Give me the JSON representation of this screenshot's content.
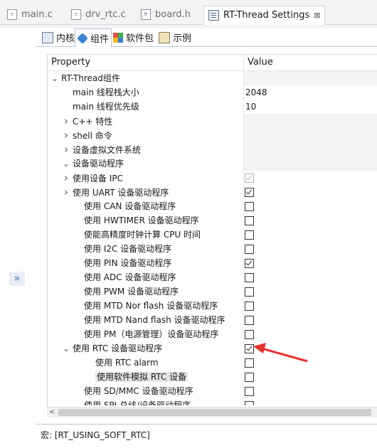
{
  "editor_tabs": [
    {
      "label": "main.c",
      "icon": "c-file-icon",
      "active": false
    },
    {
      "label": "drv_rtc.c",
      "icon": "c-file-icon",
      "active": false
    },
    {
      "label": "board.h",
      "icon": "h-file-icon",
      "active": false
    },
    {
      "label": "RT-Thread Settings",
      "icon": "settings-icon",
      "active": true
    }
  ],
  "close_glyph": "⊠",
  "collapse_glyph": "»",
  "settings_tabs": [
    {
      "label": "内核",
      "icon": "kernel-icon"
    },
    {
      "label": "组件",
      "icon": "component-icon",
      "active": true
    },
    {
      "label": "软件包",
      "icon": "package-icon"
    },
    {
      "label": "示例",
      "icon": "example-icon"
    }
  ],
  "table": {
    "col_property": "Property",
    "col_value": "Value",
    "rows": [
      {
        "label": "RT-Thread组件",
        "indent": 0,
        "twisty": "v",
        "value_type": "none",
        "gray": true
      },
      {
        "label": "main 线程栈大小",
        "indent": 2,
        "twisty": "",
        "value_type": "text",
        "value": "2048"
      },
      {
        "label": "main 线程优先级",
        "indent": 2,
        "twisty": "",
        "value_type": "text",
        "value": "10"
      },
      {
        "label": "C++ 特性",
        "indent": 1,
        "twisty": ">",
        "value_type": "none",
        "gray": true
      },
      {
        "label": "shell 命令",
        "indent": 1,
        "twisty": ">",
        "value_type": "none",
        "gray": true
      },
      {
        "label": "设备虚拟文件系统",
        "indent": 1,
        "twisty": ">",
        "value_type": "none",
        "gray": true
      },
      {
        "label": "设备驱动程序",
        "indent": 1,
        "twisty": "v",
        "value_type": "none",
        "gray": true
      },
      {
        "label": "使用设备 IPC",
        "indent": 2,
        "twisty": ">",
        "value_type": "check",
        "checked": true,
        "dim": true
      },
      {
        "label": "使用 UART 设备驱动程序",
        "indent": 2,
        "twisty": ">",
        "value_type": "check",
        "checked": true
      },
      {
        "label": "使用 CAN 设备驱动程序",
        "indent": 3,
        "twisty": "",
        "value_type": "check",
        "checked": false
      },
      {
        "label": "使用 HWTIMER 设备驱动程序",
        "indent": 3,
        "twisty": "",
        "value_type": "check",
        "checked": false
      },
      {
        "label": "使能高精度时钟计算 CPU 时间",
        "indent": 3,
        "twisty": "",
        "value_type": "check",
        "checked": false
      },
      {
        "label": "使用 I2C 设备驱动程序",
        "indent": 3,
        "twisty": "",
        "value_type": "check",
        "checked": false
      },
      {
        "label": "使用 PIN 设备驱动程序",
        "indent": 3,
        "twisty": "",
        "value_type": "check",
        "checked": true
      },
      {
        "label": "使用 ADC 设备驱动程序",
        "indent": 3,
        "twisty": "",
        "value_type": "check",
        "checked": false
      },
      {
        "label": "使用 PWM 设备驱动程序",
        "indent": 3,
        "twisty": "",
        "value_type": "check",
        "checked": false
      },
      {
        "label": "使用 MTD Nor flash 设备驱动程序",
        "indent": 3,
        "twisty": "",
        "value_type": "check",
        "checked": false
      },
      {
        "label": "使用 MTD Nand flash 设备驱动程序",
        "indent": 3,
        "twisty": "",
        "value_type": "check",
        "checked": false
      },
      {
        "label": "使用 PM（电源管理）设备驱动程序",
        "indent": 3,
        "twisty": "",
        "value_type": "check",
        "checked": false
      },
      {
        "label": "使用 RTC 设备驱动程序",
        "indent": 2,
        "twisty": "v",
        "value_type": "check",
        "checked": true
      },
      {
        "label": "使用 RTC alarm",
        "indent": 4,
        "twisty": "",
        "value_type": "check",
        "checked": false
      },
      {
        "label": "使用软件模拟 RTC 设备",
        "indent": 4,
        "twisty": "",
        "value_type": "check",
        "checked": false,
        "selected": true
      },
      {
        "label": "使用 SD/MMC 设备驱动程序",
        "indent": 3,
        "twisty": "",
        "value_type": "check",
        "checked": false
      },
      {
        "label": "使用 SPI 总线/设备驱动程序",
        "indent": 3,
        "twisty": "",
        "value_type": "check",
        "checked": false
      }
    ]
  },
  "scroll_left_glyph": "<",
  "macro_text": "宏: [RT_USING_SOFT_RTC]",
  "colors": {
    "annotation_arrow": "#e8322d",
    "accent": "#3d86d9"
  }
}
